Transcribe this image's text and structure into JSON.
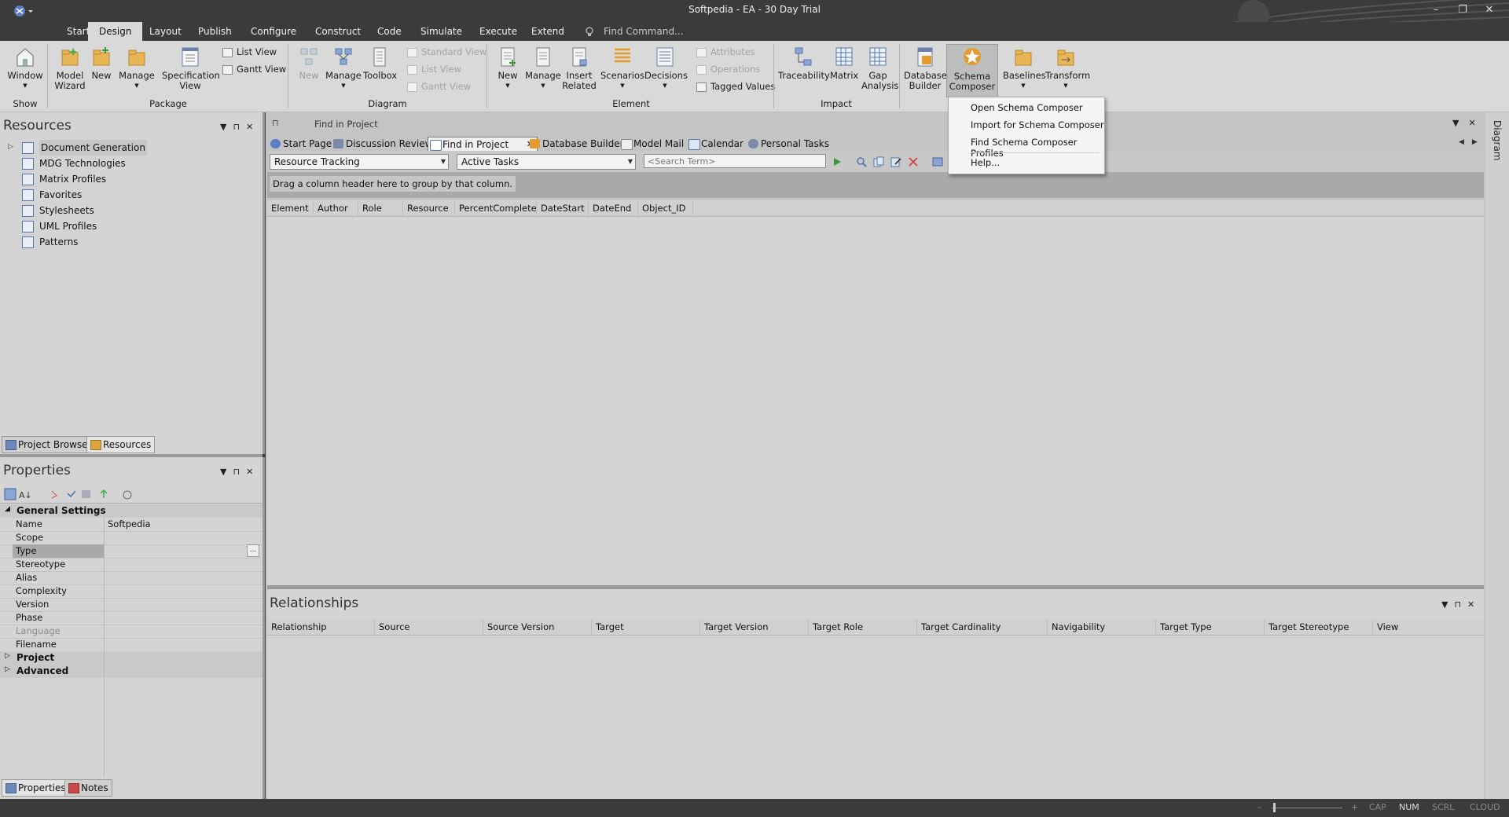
{
  "window": {
    "title": "Softpedia - EA - 30 Day Trial",
    "controls": [
      "–",
      "❐",
      "✕"
    ]
  },
  "menu": {
    "tabs": [
      "Start",
      "Design",
      "Layout",
      "Publish",
      "Configure",
      "Construct",
      "Code",
      "Simulate",
      "Execute",
      "Extend"
    ],
    "active_tab": "Design",
    "find_command": "Find Command..."
  },
  "ribbon": {
    "show": {
      "window": "Window",
      "group": "Show"
    },
    "package": {
      "model_wizard_1": "Model",
      "model_wizard_2": "Wizard",
      "new": "New",
      "manage": "Manage",
      "spec_1": "Specification",
      "spec_2": "View",
      "list_view": "List View",
      "gantt_view": "Gantt View",
      "group": "Package"
    },
    "diagram": {
      "new": "New",
      "manage": "Manage",
      "toolbox": "Toolbox",
      "standard_view": "Standard View",
      "list_view": "List View",
      "gantt_view": "Gantt View",
      "group": "Diagram"
    },
    "element": {
      "new": "New",
      "manage": "Manage",
      "insert_1": "Insert",
      "insert_2": "Related",
      "scenarios": "Scenarios",
      "decisions": "Decisions",
      "attributes": "Attributes",
      "operations": "Operations",
      "tagged_values": "Tagged Values",
      "group": "Element"
    },
    "impact": {
      "traceability": "Traceability",
      "matrix": "Matrix",
      "gap_1": "Gap",
      "gap_2": "Analysis",
      "group": "Impact"
    },
    "other": {
      "db_1": "Database",
      "db_2": "Builder",
      "schema_1": "Schema",
      "schema_2": "Composer",
      "baselines": "Baselines",
      "transform": "Transform"
    }
  },
  "schema_menu": {
    "items": [
      "Open Schema Composer",
      "Import for Schema Composer",
      "Find Schema Composer Profiles",
      "Help..."
    ]
  },
  "resources": {
    "title": "Resources",
    "items": [
      "Document Generation",
      "MDG Technologies",
      "Matrix Profiles",
      "Favorites",
      "Stylesheets",
      "UML Profiles",
      "Patterns"
    ],
    "bottom_tabs": [
      "Project Browser",
      "Resources"
    ]
  },
  "properties": {
    "title": "Properties",
    "general_section": "General Settings",
    "rows": [
      {
        "key": "Name",
        "value": "Softpedia"
      },
      {
        "key": "Scope",
        "value": ""
      },
      {
        "key": "Type",
        "value": ""
      },
      {
        "key": "Stereotype",
        "value": ""
      },
      {
        "key": "Alias",
        "value": ""
      },
      {
        "key": "Complexity",
        "value": ""
      },
      {
        "key": "Version",
        "value": ""
      },
      {
        "key": "Phase",
        "value": ""
      },
      {
        "key": "Language",
        "value": ""
      },
      {
        "key": "Filename",
        "value": ""
      }
    ],
    "type_button": "...",
    "sections": [
      "Project",
      "Advanced"
    ],
    "bottom_tabs": [
      "Properties",
      "Notes"
    ]
  },
  "main": {
    "header_title": "Find in Project",
    "tabs": [
      "Start Page",
      "Discussion Review",
      "Find in Project",
      "Database Builder",
      "Model Mail",
      "Calendar",
      "Personal Tasks"
    ],
    "active_tab": "Find in Project",
    "search_category": "Resource Tracking",
    "search_name": "Active Tasks",
    "search_placeholder": "<Search Term>",
    "group_hint": "Drag a column header here to group by that column.",
    "columns": [
      "Element",
      "Author",
      "Role",
      "Resource",
      "PercentComplete",
      "DateStart",
      "DateEnd",
      "Object_ID"
    ],
    "side_label": "Diagram"
  },
  "relationships": {
    "title": "Relationships",
    "columns": [
      "Relationship",
      "Source",
      "Source Version",
      "Target",
      "Target Version",
      "Target Role",
      "Target Cardinality",
      "Navigability",
      "Target Type",
      "Target Stereotype",
      "View"
    ]
  },
  "status": {
    "minus": "–",
    "plus": "+",
    "indicators": [
      "CAP",
      "NUM",
      "SCRL",
      "CLOUD"
    ],
    "active": "NUM"
  },
  "colors": {
    "chrome": "#3b3b3b",
    "ribbon": "#d9d9d9",
    "panel": "#d4d4d4",
    "accent": "#4a6fb5"
  }
}
